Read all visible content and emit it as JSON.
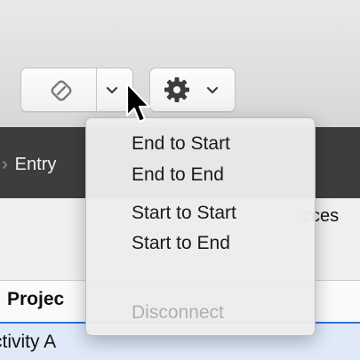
{
  "toolbar": {
    "link_button_icon": "paperclip-link-icon",
    "link_dropdown_icon": "chevron-down-icon",
    "gear_button_icon": "gear-icon",
    "gear_dropdown_icon": "chevron-down-icon"
  },
  "tab_bar": {
    "entry_label": "Entry"
  },
  "columns": {
    "successors_partial": "cces",
    "project_header": "Projec"
  },
  "rows": [
    {
      "name": "ctivity A"
    }
  ],
  "menu": {
    "items": [
      {
        "label": "End to Start",
        "enabled": true
      },
      {
        "label": "End to End",
        "enabled": true
      },
      {
        "label": "Start to Start",
        "enabled": true
      },
      {
        "label": "Start to End",
        "enabled": true
      },
      {
        "label": "Disconnect",
        "enabled": false
      }
    ]
  },
  "colors": {
    "dark_bar": "#3d3d3d",
    "selection_row": "#dfe9f7",
    "header_border": "#2f6fd8",
    "disabled_text": "#b0b0b0"
  }
}
